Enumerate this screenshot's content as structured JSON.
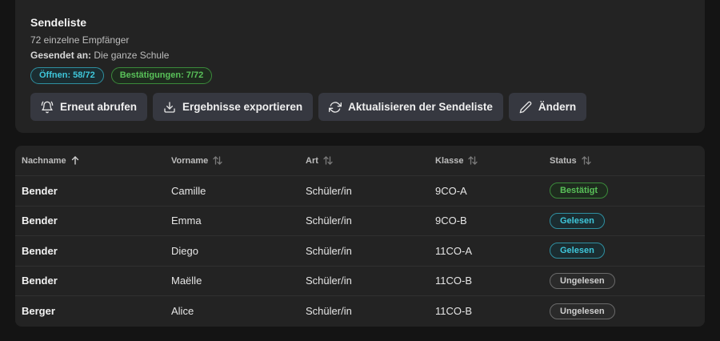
{
  "header": {
    "title": "Sendeliste",
    "recipients": "72 einzelne Empfänger",
    "sent_to_label": "Gesendet an:",
    "sent_to_value": "Die ganze Schule",
    "chip_opens": "Öffnen: 58/72",
    "chip_confirmations": "Bestätigungen: 7/72"
  },
  "actions": {
    "recall": "Erneut abrufen",
    "export": "Ergebnisse exportieren",
    "refresh": "Aktualisieren der Sendeliste",
    "edit": "Ändern"
  },
  "table": {
    "columns": [
      "Nachname",
      "Vorname",
      "Art",
      "Klasse",
      "Status"
    ],
    "rows": [
      {
        "lastname": "Bender",
        "firstname": "Camille",
        "type": "Schüler/in",
        "class": "9CO-A",
        "status": "Bestätigt",
        "status_kind": "confirmed"
      },
      {
        "lastname": "Bender",
        "firstname": "Emma",
        "type": "Schüler/in",
        "class": "9CO-B",
        "status": "Gelesen",
        "status_kind": "read"
      },
      {
        "lastname": "Bender",
        "firstname": "Diego",
        "type": "Schüler/in",
        "class": "11CO-A",
        "status": "Gelesen",
        "status_kind": "read"
      },
      {
        "lastname": "Bender",
        "firstname": "Maëlle",
        "type": "Schüler/in",
        "class": "11CO-B",
        "status": "Ungelesen",
        "status_kind": "unread"
      },
      {
        "lastname": "Berger",
        "firstname": "Alice",
        "type": "Schüler/in",
        "class": "11CO-B",
        "status": "Ungelesen",
        "status_kind": "unread"
      }
    ]
  },
  "colors": {
    "background": "#141414",
    "card": "#232323",
    "button": "#363840",
    "accent_teal": "#3fc7db",
    "accent_green": "#59c159"
  }
}
